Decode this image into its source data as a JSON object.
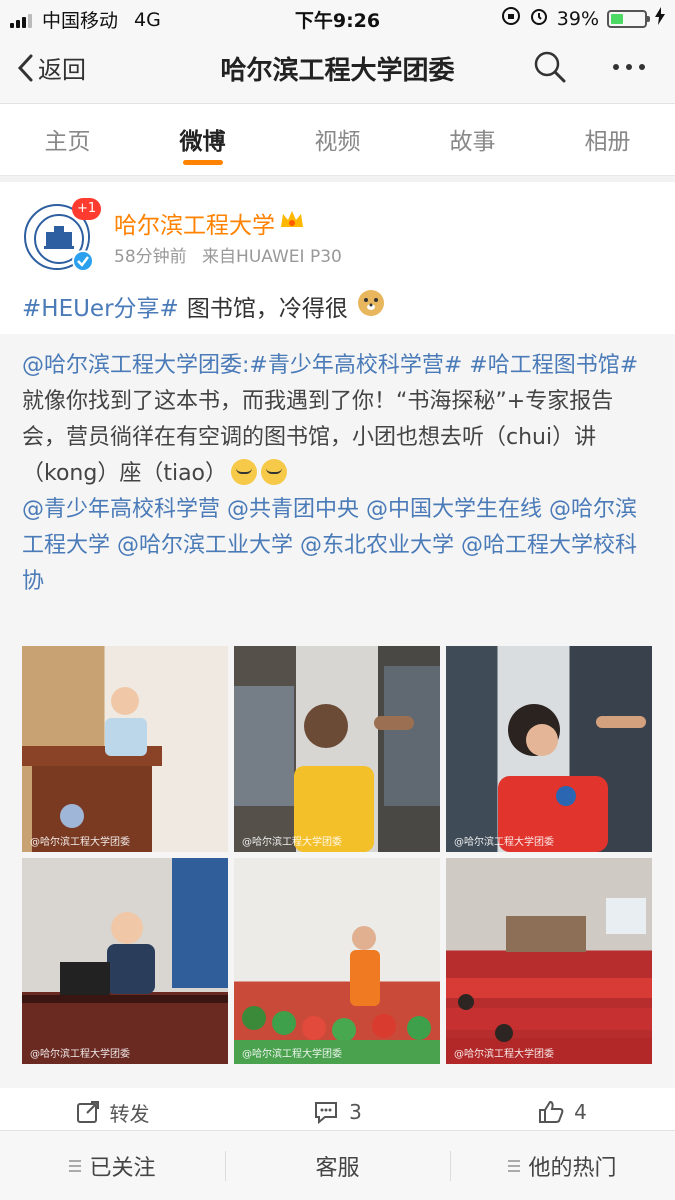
{
  "status_bar": {
    "carrier": "中国移动",
    "network": "4G",
    "time": "下午9:26",
    "battery_percent": "39%",
    "battery_level": 0.39
  },
  "nav": {
    "back_label": "返回",
    "title": "哈尔滨工程大学团委"
  },
  "tabs": [
    {
      "label": "主页",
      "active": false
    },
    {
      "label": "微博",
      "active": true
    },
    {
      "label": "视频",
      "active": false
    },
    {
      "label": "故事",
      "active": false
    },
    {
      "label": "相册",
      "active": false
    }
  ],
  "post": {
    "badge": "+1",
    "author": "哈尔滨工程大学",
    "time": "58分钟前",
    "source": "来自HUAWEI P30",
    "hashtag": "#HEUer分享#",
    "text": "图书馆，冷得很",
    "repost": {
      "line1_link": "@哈尔滨工程大学团委:#青少年高校科学营# #哈工程图书馆#",
      "body": "就像你找到了这本书，而我遇到了你！“书海探秘”+专家报告会，营员徜徉在有空调的图书馆，小团也想去听（chui）讲（kong）座（tiao）",
      "mentions": "@青少年高校科学营 @共青团中央 @中国大学生在线 @哈尔滨工程大学 @哈尔滨工业大学 @东北农业大学 @哈工程大学校科协"
    },
    "watermark": "@哈尔滨工程大学团委"
  },
  "actions": {
    "repost_label": "转发",
    "comment_count": "3",
    "like_count": "4"
  },
  "bottom_bar": {
    "follow_label": "已关注",
    "service_label": "客服",
    "hot_label": "他的热门"
  },
  "colors": {
    "accent": "#ff8200",
    "link": "#4a7bb8"
  }
}
